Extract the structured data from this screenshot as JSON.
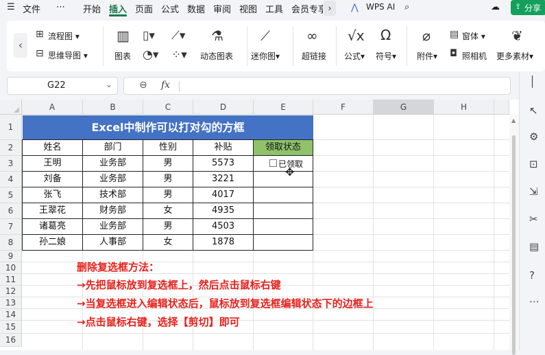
{
  "menubar": {
    "file": "文件",
    "more": "⋯",
    "tabs": [
      "开始",
      "插入",
      "页面",
      "公式",
      "数据",
      "审阅",
      "视图",
      "工具",
      "会员专享"
    ],
    "wps_ai": "WPS AI",
    "share": "分享"
  },
  "ribbon": {
    "flowchart": "流程图",
    "mindmap": "思维导图",
    "chart": "图表",
    "dynamic_chart": "动态图表",
    "sparkline": "迷你图",
    "hyperlink": "超链接",
    "formula": "公式",
    "symbol": "符号",
    "attachment": "附件",
    "font": "窗体",
    "camera": "照相机",
    "more_material": "更多素材"
  },
  "formula": {
    "namebox": "G22",
    "fx": "fx",
    "value": ""
  },
  "columns": [
    "A",
    "B",
    "C",
    "D",
    "E",
    "F",
    "G",
    "H"
  ],
  "rows": [
    "1",
    "2",
    "3",
    "4",
    "5",
    "6",
    "7",
    "8",
    "9",
    "10",
    "11",
    "12",
    "13",
    "14",
    "15",
    "16"
  ],
  "table": {
    "title": "Excel中制作可以打对勾的方框",
    "headers": [
      "姓名",
      "部门",
      "性别",
      "补贴",
      "领取状态"
    ],
    "rows": [
      [
        "王明",
        "业务部",
        "男",
        "5573",
        ""
      ],
      [
        "刘备",
        "业务部",
        "男",
        "3221",
        ""
      ],
      [
        "张飞",
        "技术部",
        "男",
        "4017",
        ""
      ],
      [
        "王翠花",
        "财务部",
        "女",
        "4935",
        ""
      ],
      [
        "诸葛亮",
        "业务部",
        "男",
        "4503",
        ""
      ],
      [
        "孙二娘",
        "人事部",
        "女",
        "1878",
        ""
      ]
    ],
    "checkbox_label": "已领取"
  },
  "instructions": [
    "删除复选框方法：",
    "→先把鼠标放到复选框上，然后点击鼠标右键",
    "→当复选框进入编辑状态后，鼠标放到复选框编辑状态下的边框上",
    "→点击鼠标右键，选择【剪切】即可"
  ],
  "colors": {
    "accent": "#1a7a4c",
    "title_bg": "#4472c4",
    "header_highlight": "#8fc26a",
    "instruction": "#e8201a",
    "share_bg": "#12a05c"
  }
}
